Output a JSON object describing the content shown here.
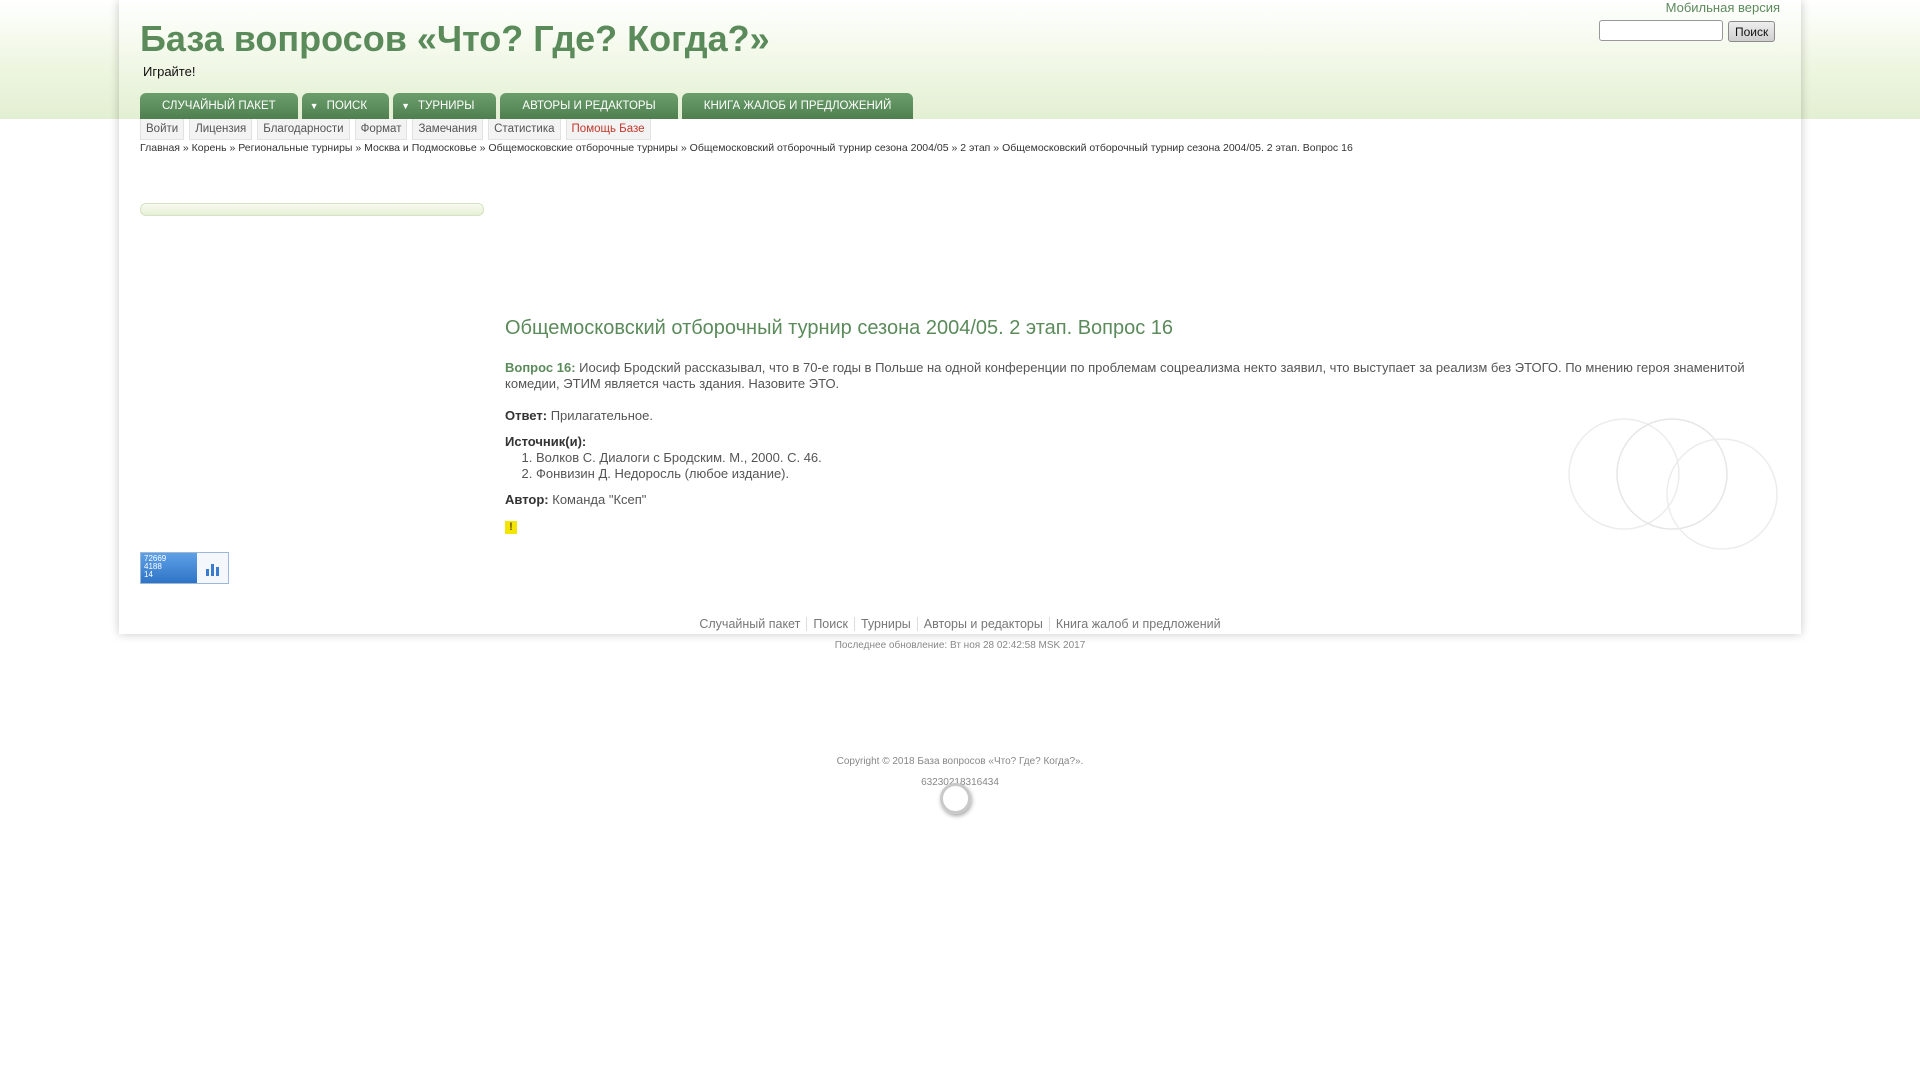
{
  "site": {
    "title": "База вопросов «Что? Где? Когда?»",
    "slogan": "Играйте!",
    "mobile_link": "Мобильная версия"
  },
  "search": {
    "placeholder": "",
    "value": "",
    "button_label": "Поиск"
  },
  "mainnav": [
    {
      "label": "СЛУЧАЙНЫЙ ПАКЕТ",
      "dropdown": false
    },
    {
      "label": "ПОИСК",
      "dropdown": true
    },
    {
      "label": "ТУРНИРЫ",
      "dropdown": true
    },
    {
      "label": "АВТОРЫ И РЕДАКТОРЫ",
      "dropdown": false
    },
    {
      "label": "КНИГА ЖАЛОБ И ПРЕДЛОЖЕНИЙ",
      "dropdown": false
    }
  ],
  "mainnav_arrow": "▼",
  "subnav": [
    "Войти",
    "Лицензия",
    "Благодарности",
    "Формат",
    "Замечания",
    "Статистика",
    "Помощь Базе"
  ],
  "breadcrumb": {
    "separator": "»",
    "items": [
      "Главная",
      "Корень",
      "Региональные турниры",
      "Москва и Подмосковье",
      "Общемосковские отборочные турниры",
      "Общемосковский отборочный турнир сезона 2004/05",
      "2 этап",
      "Общемосковский отборочный турнир сезона 2004/05. 2 этап. Вопрос 16"
    ]
  },
  "counter": {
    "line1": "72669",
    "line2": "4188",
    "line3": "14"
  },
  "question": {
    "title": "Общемосковский отборочный турнир сезона 2004/05. 2 этап. Вопрос 16",
    "label": "Вопрос 16:",
    "text": "Иосиф Бродский рассказывал, что в 70-е годы в Польше на одной конференции по проблемам соцреализма некто заявил, что выступает за реализм без ЭТОГО. По мнению героя знаменитой комедии, ЭТИМ является часть здания. Назовите ЭТО.",
    "answer_label": "Ответ:",
    "answer": "Прилагательное.",
    "sources_label": "Источник(и):",
    "sources": [
      "Волков С. Диалоги с Бродским. М., 2000. С. 46.",
      "Фонвизин Д. Недоросль (любое издание)."
    ],
    "author_label": "Автор:",
    "author": "Команда \"Ксеп\"",
    "warning": "!"
  },
  "footer": {
    "links": [
      "Случайный пакет",
      "Поиск",
      "Турниры",
      "Авторы и редакторы",
      "Книга жалоб и предложений"
    ],
    "updated": "Последнее обновление: Вт ноя 28 02:42:58 MSK 2017",
    "copyright": "Copyright © 2018 База вопросов «Что? Где? Когда?».",
    "code": "63230218316434"
  },
  "colors": {
    "accent": "#5b8a5b",
    "nav": "#5a8a5a",
    "help": "#c0392b"
  }
}
